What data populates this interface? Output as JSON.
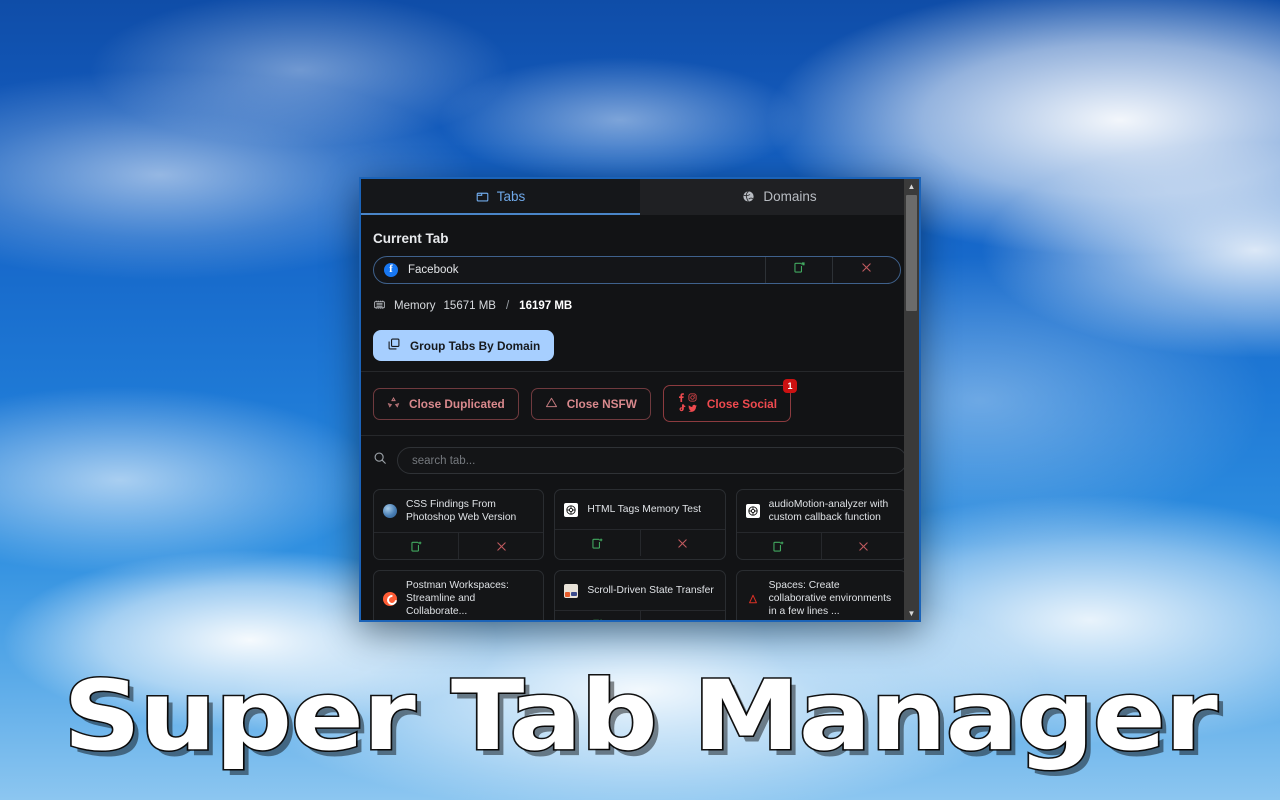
{
  "app_title": "Super Tab Manager",
  "popup": {
    "tabs": [
      {
        "label": "Tabs",
        "icon": "tabs-icon",
        "active": true
      },
      {
        "label": "Domains",
        "icon": "globe-icon",
        "active": false
      }
    ],
    "current_tab": {
      "section_title": "Current Tab",
      "title": "Facebook",
      "favicon": "facebook-icon",
      "open_action_icon": "open-new-icon",
      "close_action_icon": "close-icon"
    },
    "memory": {
      "icon": "memory-chip-icon",
      "label": "Memory",
      "used": "15671 MB",
      "separator": "/",
      "total": "16197 MB"
    },
    "group_button": {
      "label": "Group Tabs By Domain",
      "icon": "copy-layers-icon",
      "color": "#a7cfff"
    },
    "danger_actions": [
      {
        "label": "Close Duplicated",
        "icon": "recycle-icon",
        "badge": null
      },
      {
        "label": "Close NSFW",
        "icon": "warning-triangle-icon",
        "badge": null
      },
      {
        "label": "Close Social",
        "icon": "social-icons",
        "badge": "1"
      }
    ],
    "search": {
      "icon": "search-icon",
      "placeholder": "search tab...",
      "value": ""
    },
    "tab_cards": [
      {
        "title": "CSS Findings From Photoshop Web Version",
        "favicon": "globe-favicon"
      },
      {
        "title": "HTML Tags Memory Test",
        "favicon": "dark-target-favicon"
      },
      {
        "title": "audioMotion-analyzer with custom callback function",
        "favicon": "dark-target-favicon"
      },
      {
        "title": "Postman Workspaces: Streamline and Collaborate...",
        "favicon": "postman-favicon"
      },
      {
        "title": "Scroll-Driven State Transfer",
        "favicon": "image-favicon"
      },
      {
        "title": "Spaces: Create collaborative environments in a few lines ...",
        "favicon": "letter-a-favicon"
      }
    ],
    "card_action_icons": {
      "open": "open-new-icon",
      "close": "close-icon"
    },
    "scrollbar": {
      "up_arrow": "▲",
      "down_arrow": "▼"
    }
  }
}
